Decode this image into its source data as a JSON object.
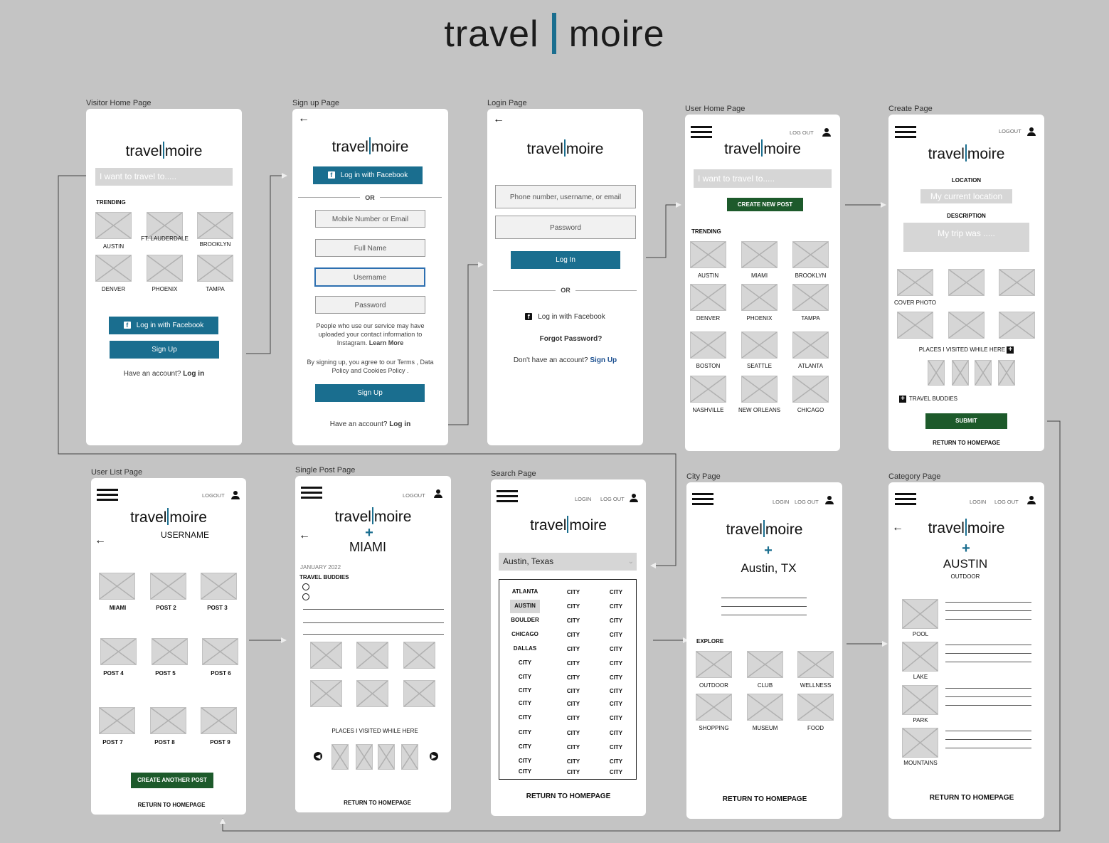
{
  "header": {
    "left": "travel",
    "right": "moire"
  },
  "logo": {
    "left": "travel",
    "right": "moire"
  },
  "screens": {
    "visitor": {
      "label": "Visitor Home Page",
      "search": "I want to travel to.....",
      "trending": "TRENDING",
      "cities": [
        "AUSTIN",
        "FT. LAUDERDALE",
        "BROOKLYN",
        "DENVER",
        "PHOENIX",
        "TAMPA"
      ],
      "fb": "Log in with Facebook",
      "signup": "Sign Up",
      "have": "Have an account?",
      "login": "Log in"
    },
    "signup": {
      "label": "Sign up Page",
      "fb": "Log in with Facebook",
      "or": "OR",
      "mobile": "Mobile Number or Email",
      "fullname": "Full Name",
      "username": "Username",
      "password": "Password",
      "info": "People who use our service may have uploaded your contact information to Instagram.",
      "learn": "Learn More",
      "terms": "By signing up, you agree to our Terms , Data Policy and Cookies Policy .",
      "signup": "Sign Up",
      "have": "Have an account?",
      "login": "Log in"
    },
    "login": {
      "label": "Login Page",
      "phone": "Phone number, username, or email",
      "password": "Password",
      "login": "Log In",
      "or": "OR",
      "fb": "Log in with Facebook",
      "forgot": "Forgot Password?",
      "dont": "Don't have an account?",
      "signup": "Sign Up"
    },
    "userhome": {
      "label": "User Home Page",
      "logout": "LOG OUT",
      "search": "I want to travel to.....",
      "create": "CREATE NEW POST",
      "trending": "TRENDING",
      "cities": [
        "AUSTIN",
        "MIAMI",
        "BROOKLYN",
        "DENVER",
        "PHOENIX",
        "TAMPA",
        "BOSTON",
        "SEATTLE",
        "ATLANTA",
        "NASHVILLE",
        "NEW ORLEANS",
        "CHICAGO"
      ]
    },
    "create": {
      "label": "Create Page",
      "logout": "LOGOUT",
      "location": "LOCATION",
      "location_ph": "My current location",
      "description": "DESCRIPTION",
      "desc_ph": "My trip was .....",
      "cover": "COVER PHOTO",
      "places": "PLACES I VISITED WHILE HERE",
      "buddies": "TRAVEL BUDDIES",
      "submit": "SUBMIT",
      "ret": "RETURN TO HOMEPAGE"
    },
    "userlist": {
      "label": "User List Page",
      "logout": "LOGOUT",
      "username": "USERNAME",
      "posts": [
        "MIAMI",
        "POST 2",
        "POST 3",
        "POST 4",
        "POST 5",
        "POST 6",
        "POST 7",
        "POST 8",
        "POST 9"
      ],
      "create": "CREATE ANOTHER POST",
      "ret": "RETURN TO HOMEPAGE"
    },
    "single": {
      "label": "Single Post Page",
      "logout": "LOGOUT",
      "city": "MIAMI",
      "date": "JANUARY 2022",
      "buddies": "TRAVEL BUDDIES",
      "places": "PLACES I VISITED WHILE HERE",
      "ret": "RETURN TO HOMEPAGE"
    },
    "search": {
      "label": "Search Page",
      "login": "LOGIN",
      "logout": "LOG OUT",
      "select": "Austin, Texas",
      "col1": [
        "ATLANTA",
        "AUSTIN",
        "BOULDER",
        "CHICAGO",
        "DALLAS",
        "CITY",
        "CITY",
        "CITY",
        "CITY",
        "CITY",
        "CITY",
        "CITY",
        "CITY",
        "CITY"
      ],
      "city": "CITY",
      "ret": "RETURN TO HOMEPAGE"
    },
    "city": {
      "label": "City Page",
      "login": "LOGIN",
      "logout": "LOG OUT",
      "name": "Austin, TX",
      "explore": "EXPLORE",
      "cats": [
        "OUTDOOR",
        "CLUB",
        "WELLNESS",
        "SHOPPING",
        "MUSEUM",
        "FOOD"
      ],
      "ret": "RETURN TO HOMEPAGE"
    },
    "category": {
      "label": "Category Page",
      "login": "LOGIN",
      "logout": "LOG OUT",
      "name": "AUSTIN",
      "sub": "OUTDOOR",
      "items": [
        "POOL",
        "LAKE",
        "PARK",
        "MOUNTAINS"
      ],
      "ret": "RETURN TO HOMEPAGE"
    }
  },
  "colors": {
    "brand": "#1a6e8f",
    "green": "#1d5a2b",
    "background": "#c4c4c4"
  }
}
